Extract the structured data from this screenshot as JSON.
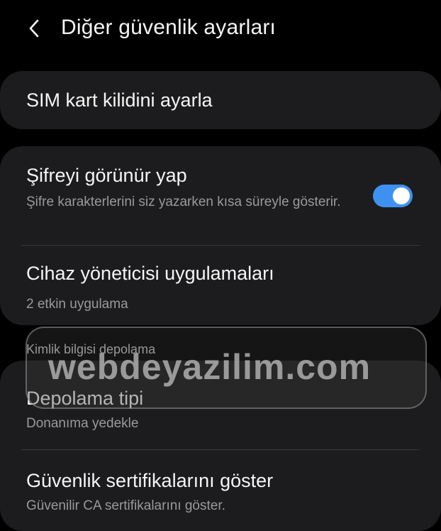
{
  "header": {
    "title": "Diğer güvenlik ayarları",
    "back_icon": "chevron-left-icon"
  },
  "items": {
    "sim_lock": {
      "title": "SIM kart kilidini ayarla"
    },
    "show_password": {
      "title": "Şifreyi görünür yap",
      "subtitle": "Şifre karakterlerini siz yazarken kısa süreyle gösterir.",
      "toggle_on": true
    },
    "device_admin": {
      "title": "Cihaz yöneticisi uygulamaları",
      "subtitle": "2 etkin uygulama"
    },
    "storage_type": {
      "title": "Depolama tipi",
      "subtitle": "Donanıma yedekle"
    },
    "security_certs": {
      "title": "Güvenlik sertifikalarını göster",
      "subtitle": "Güvenilir CA sertifikalarını göster."
    }
  },
  "section": {
    "credential_storage": "Kimlik bilgisi depolama"
  },
  "watermark": {
    "text": "webdeyazilim.com"
  },
  "colors": {
    "background": "#000000",
    "card": "#1c1c1e",
    "accent": "#3e91f0",
    "subtitle": "#9a9a9a"
  }
}
